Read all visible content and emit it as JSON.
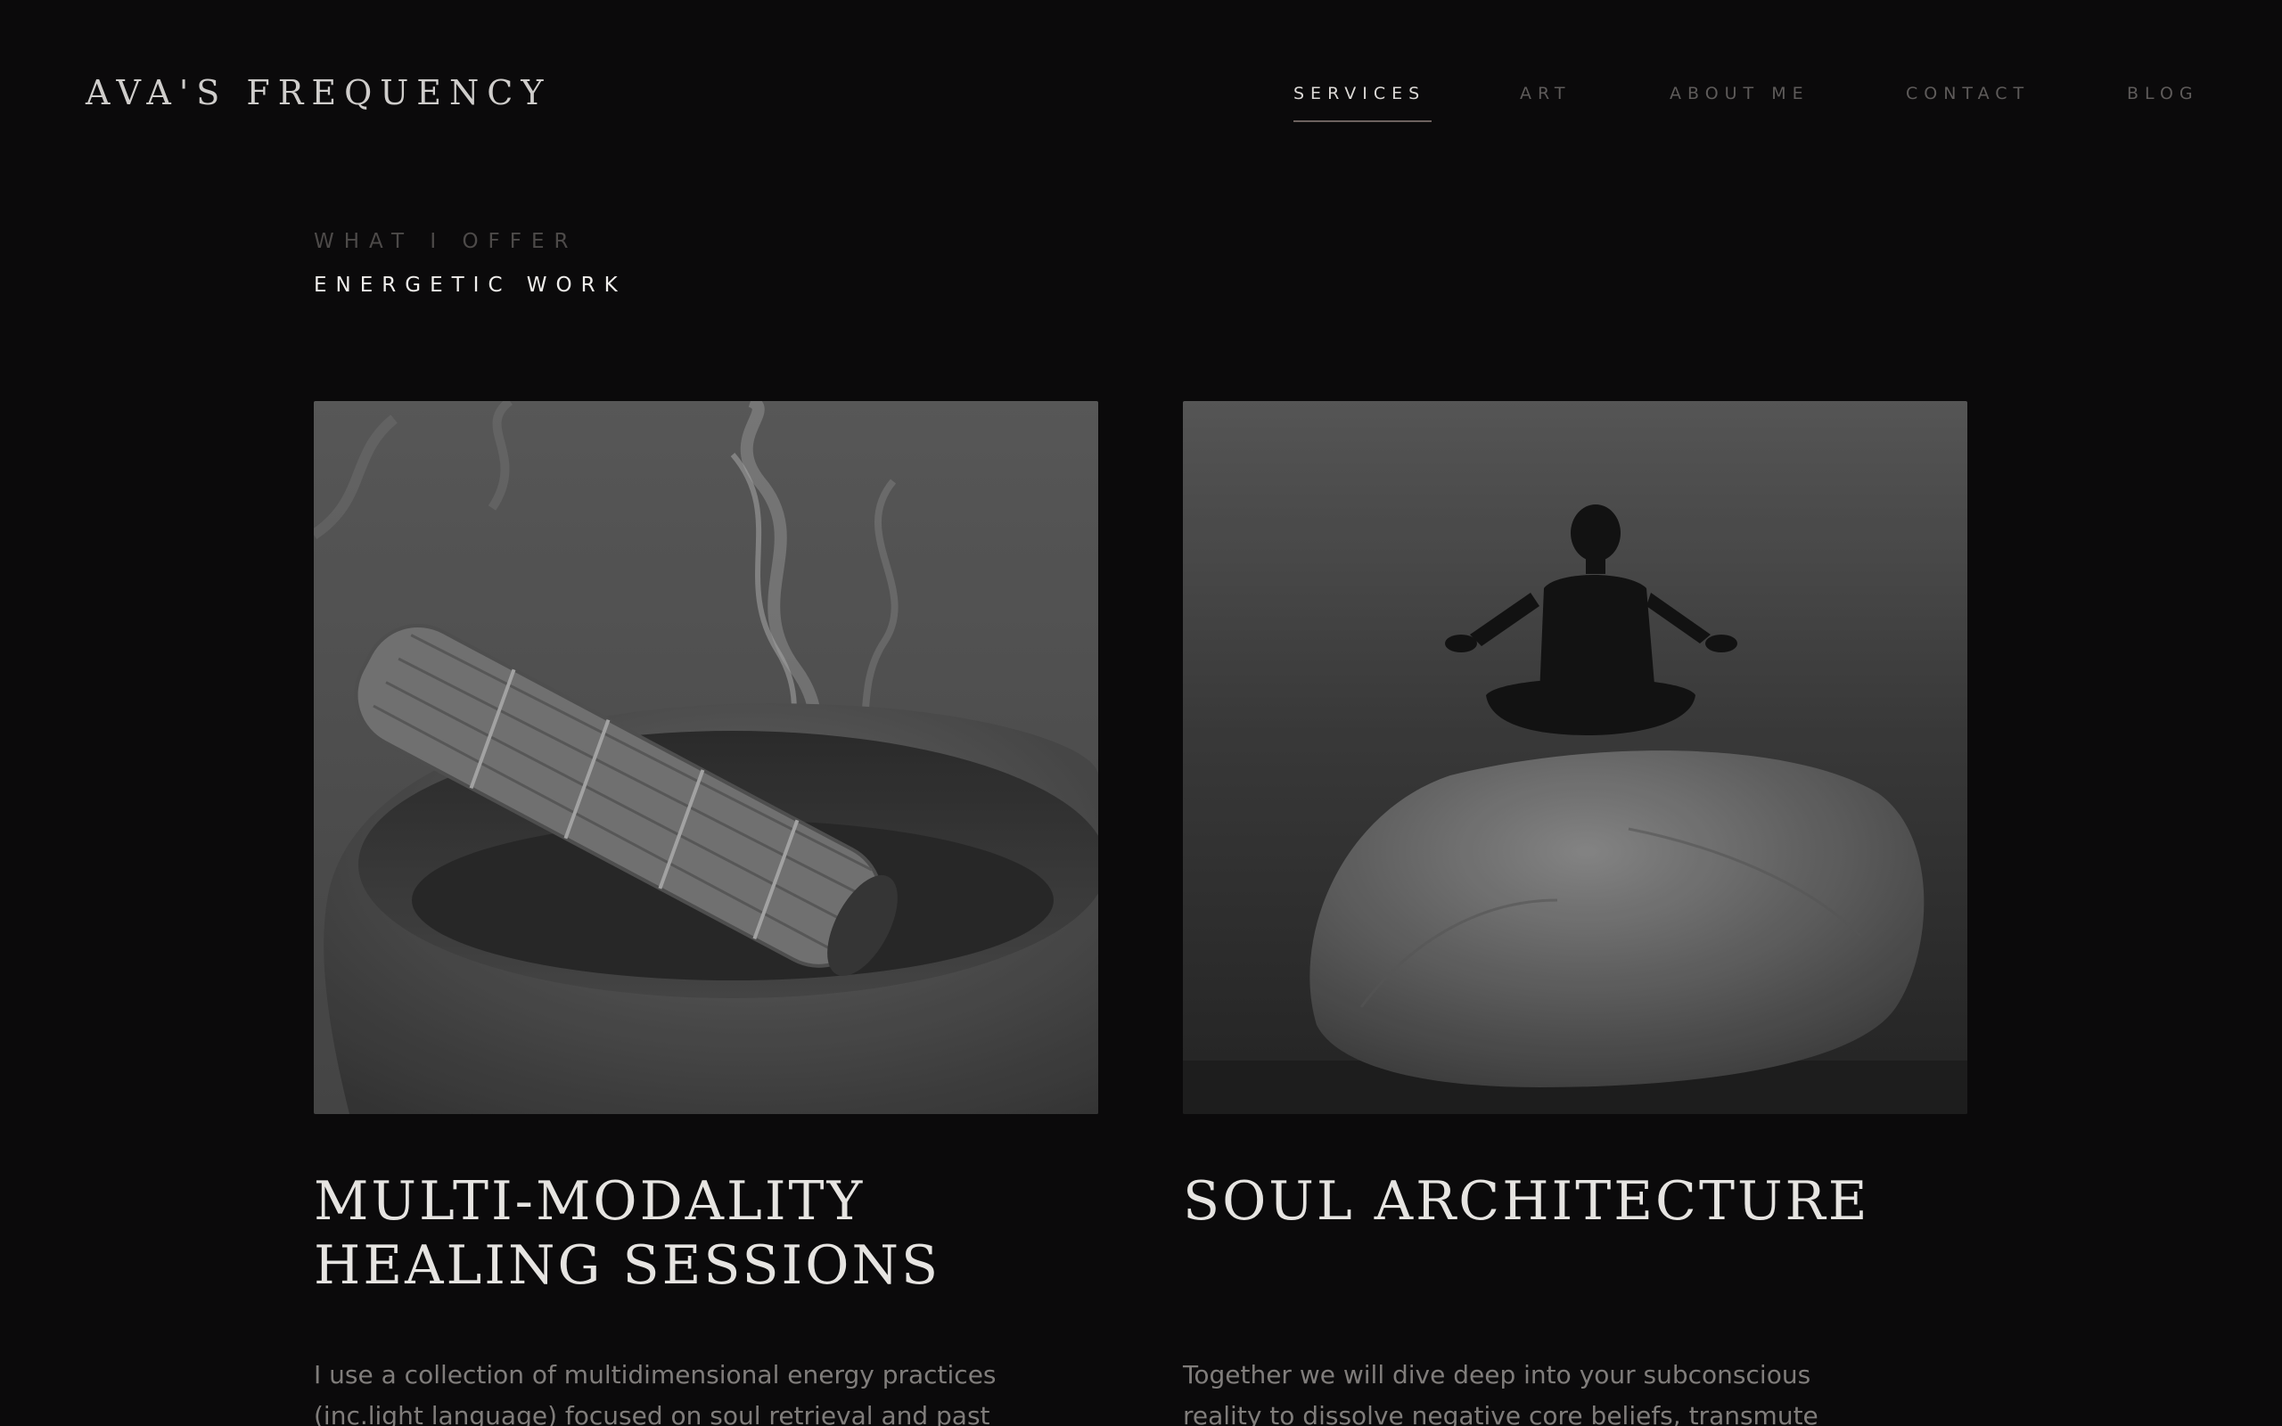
{
  "header": {
    "logo": "AVA'S FREQUENCY",
    "nav": [
      {
        "label": "SERVICES",
        "active": true
      },
      {
        "label": "ART",
        "active": false
      },
      {
        "label": "ABOUT ME",
        "active": false
      },
      {
        "label": "CONTACT",
        "active": false
      },
      {
        "label": "BLOG",
        "active": false
      }
    ]
  },
  "section": {
    "eyebrow": "WHAT I OFFER",
    "subhead": "ENERGETIC WORK"
  },
  "cards": [
    {
      "title": "MULTI-MODALITY\nHEALING SESSIONS",
      "description": "I use a collection of multidimensional energy practices (inc.light language) focused on soul retrieval and past",
      "image": "smoking-sage-bundle-in-stone-bowl"
    },
    {
      "title": "SOUL ARCHITECTURE",
      "description": "Together we will dive deep into your subconscious reality to dissolve negative core beliefs, transmute",
      "image": "person-meditating-on-rock"
    }
  ],
  "colors": {
    "background": "#0b0a0b",
    "nav_active": "#dcd9d6",
    "nav_inactive": "#5e5b5a",
    "underline": "#6d625f",
    "body_text": "#807d7b"
  }
}
